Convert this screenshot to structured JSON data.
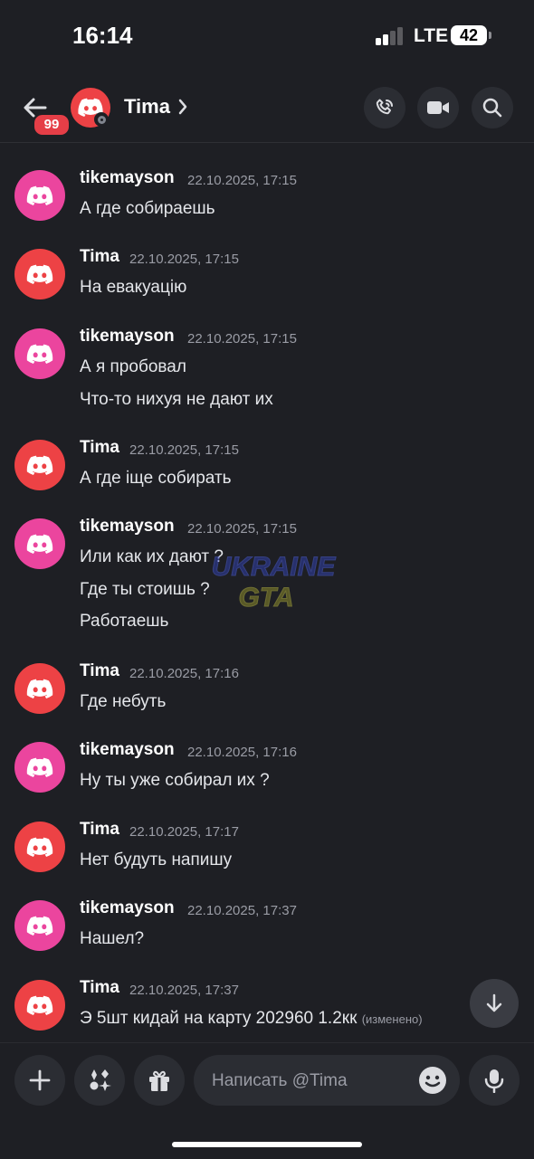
{
  "status_bar": {
    "time": "16:14",
    "network": "LTE",
    "battery": "42"
  },
  "header": {
    "back_badge": "99",
    "contact_name": "Tima"
  },
  "messages": [
    {
      "user": "tikemayson",
      "timestamp": "22.10.2025, 17:15",
      "avatar_color": "#eb459e",
      "lines": [
        "А где собираешь"
      ]
    },
    {
      "user": "Tima",
      "timestamp": "22.10.2025, 17:15",
      "avatar_color": "#ed4245",
      "lines": [
        "На евакуацію"
      ]
    },
    {
      "user": "tikemayson",
      "timestamp": "22.10.2025, 17:15",
      "avatar_color": "#eb459e",
      "lines": [
        "А я пробовал",
        "Что-то нихуя не дают их"
      ]
    },
    {
      "user": "Tima",
      "timestamp": "22.10.2025, 17:15",
      "avatar_color": "#ed4245",
      "lines": [
        "А где іще собирать"
      ]
    },
    {
      "user": "tikemayson",
      "timestamp": "22.10.2025, 17:15",
      "avatar_color": "#eb459e",
      "lines": [
        "Или как их дают ?",
        "Где ты стоишь ?",
        "Работаешь"
      ]
    },
    {
      "user": "Tima",
      "timestamp": "22.10.2025, 17:16",
      "avatar_color": "#ed4245",
      "lines": [
        "Где небуть"
      ]
    },
    {
      "user": "tikemayson",
      "timestamp": "22.10.2025, 17:16",
      "avatar_color": "#eb459e",
      "lines": [
        "Ну ты уже собирал их ?"
      ]
    },
    {
      "user": "Tima",
      "timestamp": "22.10.2025, 17:17",
      "avatar_color": "#ed4245",
      "lines": [
        "Нет будуть напишу"
      ]
    },
    {
      "user": "tikemayson",
      "timestamp": "22.10.2025, 17:37",
      "avatar_color": "#eb459e",
      "lines": [
        "Нашел?"
      ]
    },
    {
      "user": "Tima",
      "timestamp": "22.10.2025, 17:37",
      "avatar_color": "#ed4245",
      "lines": [
        "Э 5шт кидай на карту 202960 1.2кк"
      ],
      "edited": "(изменено)"
    }
  ],
  "watermark": {
    "line1": "UKRAINE",
    "line2": "GTA"
  },
  "composer": {
    "placeholder": "Написать @Tima"
  },
  "icons": {
    "back": "arrow-left-icon",
    "call": "phone-icon",
    "video": "video-camera-icon",
    "search": "search-icon",
    "plus": "plus-icon",
    "apps": "apps-sparkle-icon",
    "gift": "gift-icon",
    "emoji": "emoji-icon",
    "mic": "microphone-icon",
    "scroll": "arrow-down-icon",
    "avatar": "discord-logo-icon"
  }
}
